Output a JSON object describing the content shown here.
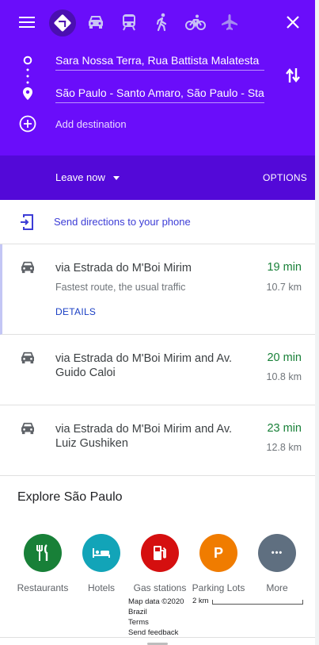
{
  "colors": {
    "header": "#6a0dfa",
    "subbar": "#5309d8",
    "travel_time": "#188038",
    "link": "#3c3cd6"
  },
  "modes": [
    {
      "icon": "menu-icon"
    },
    {
      "icon": "driving-mode-icon",
      "active": true
    },
    {
      "icon": "car-icon"
    },
    {
      "icon": "transit-icon"
    },
    {
      "icon": "walking-icon"
    },
    {
      "icon": "cycling-icon"
    },
    {
      "icon": "flight-icon"
    },
    {
      "icon": "close-icon"
    }
  ],
  "directions": {
    "origin": "Sara Nossa Terra, Rua Battista Malatesta",
    "destination": "São Paulo - Santo Amaro, São Paulo - State of São Paulo",
    "add_destination": "Add destination",
    "leave": "Leave now",
    "options": "OPTIONS"
  },
  "send_to_phone": "Send directions to your phone",
  "routes": [
    {
      "title": "via Estrada do M'Boi Mirim",
      "subtitle": "Fastest route, the usual traffic",
      "time": "19 min",
      "distance": "10.7 km",
      "details": "DETAILS"
    },
    {
      "title": "via Estrada do M'Boi Mirim and Av. Guido Caloi",
      "time": "20 min",
      "distance": "10.8 km"
    },
    {
      "title": "via Estrada do M'Boi Mirim and Av. Luiz Gushiken",
      "time": "23 min",
      "distance": "12.8 km"
    }
  ],
  "explore": {
    "title": "Explore São Paulo",
    "categories": [
      {
        "label": "Restaurants",
        "icon": "restaurant-icon",
        "color": "#188038"
      },
      {
        "label": "Hotels",
        "icon": "hotel-icon",
        "color": "#12a4b8"
      },
      {
        "label": "Gas stations",
        "icon": "gas-station-icon",
        "color": "#d50f0f"
      },
      {
        "label": "Parking Lots",
        "icon": "parking-icon",
        "color": "#f07c00",
        "glyph": "P"
      },
      {
        "label": "More",
        "icon": "more-icon",
        "color": "#5f6f80",
        "glyph": "•••"
      }
    ]
  },
  "map_info": {
    "data": "Map data ©2020",
    "country": "Brazil",
    "terms": "Terms",
    "feedback": "Send feedback",
    "scale": "2 km"
  }
}
